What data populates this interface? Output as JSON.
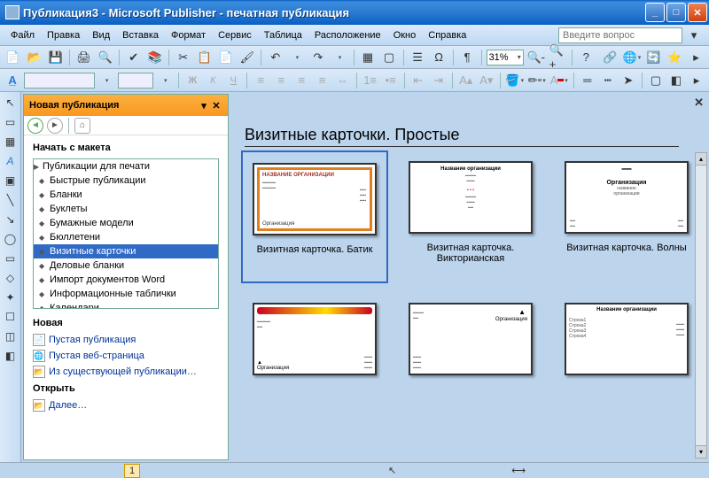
{
  "window": {
    "title": "Публикация3 - Microsoft Publisher - печатная публикация"
  },
  "menu": {
    "file": "Файл",
    "edit": "Правка",
    "view": "Вид",
    "insert": "Вставка",
    "format": "Формат",
    "service": "Сервис",
    "table": "Таблица",
    "layout": "Расположение",
    "window": "Окно",
    "help": "Справка",
    "help_placeholder": "Введите вопрос"
  },
  "zoom": "31%",
  "taskpane": {
    "title": "Новая публикация",
    "section_start": "Начать с макета",
    "tree": {
      "root": "Публикации для печати",
      "items": [
        "Быстрые публикации",
        "Бланки",
        "Буклеты",
        "Бумажные модели",
        "Бюллетени",
        "Визитные карточки",
        "Деловые бланки",
        "Импорт документов Word",
        "Информационные таблички",
        "Календари"
      ],
      "selected_index": 5
    },
    "section_new": "Новая",
    "new_items": [
      "Пустая публикация",
      "Пустая веб-страница",
      "Из существующей публикации…"
    ],
    "section_open": "Открыть",
    "open_items": [
      "Далее…"
    ]
  },
  "main": {
    "heading": "Визитные карточки. Простые",
    "cards": [
      {
        "label": "Визитная карточка. Батик",
        "selected": true
      },
      {
        "label": "Визитная карточка. Викторианская",
        "selected": false
      },
      {
        "label": "Визитная карточка. Волны",
        "selected": false
      },
      {
        "label": "",
        "selected": false
      },
      {
        "label": "",
        "selected": false
      },
      {
        "label": "",
        "selected": false
      }
    ]
  },
  "status": {
    "page": "1"
  }
}
